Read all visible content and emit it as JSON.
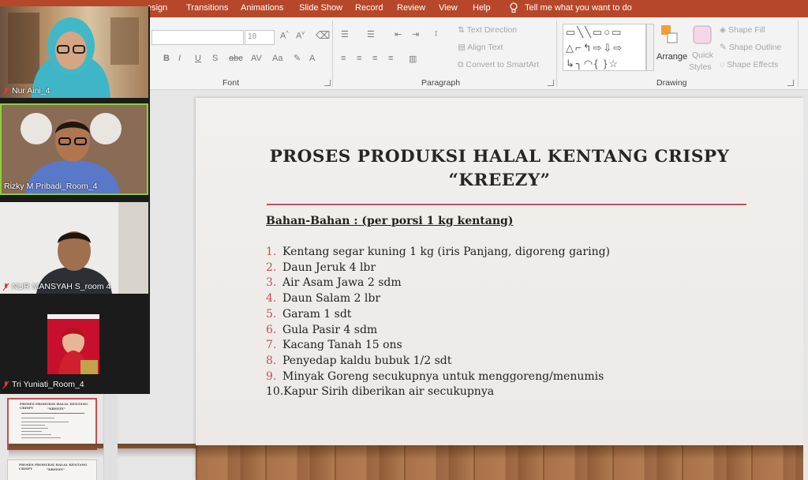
{
  "ribbon_tabs": [
    "esign",
    "Transitions",
    "Animations",
    "Slide Show",
    "Record",
    "Review",
    "View",
    "Help"
  ],
  "tell_me": "Tell me what you want to do",
  "font_group": {
    "label": "Font",
    "size_value": "18"
  },
  "paragraph_group": {
    "label": "Paragraph",
    "text_direction": "Text Direction",
    "align_text": "Align Text",
    "convert_smartart": "Convert to SmartArt"
  },
  "drawing_group": {
    "label": "Drawing",
    "arrange": "Arrange",
    "quick_styles_1": "Quick",
    "quick_styles_2": "Styles",
    "shape_fill": "Shape Fill",
    "shape_outline": "Shape Outline",
    "shape_effects": "Shape Effects"
  },
  "participants": [
    {
      "name": "Nur Aini_4"
    },
    {
      "name": "Rizky M Pribadi_Room_4"
    },
    {
      "name": "NUR MANSYAH S_room 4"
    },
    {
      "name": "Tri Yuniati_Room_4"
    }
  ],
  "slide": {
    "title_line1": "PROSES PRODUKSI HALAL KENTANG CRISPY",
    "title_line2": "“KREEZY”",
    "subheading": "Bahan-Bahan : (per porsi 1 kg kentang)",
    "items": [
      {
        "num": "1.",
        "text": "Kentang segar kuning 1 kg (iris Panjang, digoreng garing)"
      },
      {
        "num": "2.",
        "text": "Daun Jeruk 4 lbr"
      },
      {
        "num": "3.",
        "text": "Air Asam Jawa 2 sdm"
      },
      {
        "num": "4.",
        "text": "Daun Salam 2 lbr"
      },
      {
        "num": "5.",
        "text": "Garam 1 sdt"
      },
      {
        "num": "6.",
        "text": "Gula Pasir 4 sdm"
      },
      {
        "num": "7.",
        "text": "Kacang Tanah 15 ons"
      },
      {
        "num": "8.",
        "text": "Penyedap kaldu bubuk 1/2 sdt"
      },
      {
        "num": "9.",
        "text": "Minyak Goreng secukupnya untuk menggoreng/menumis"
      },
      {
        "num": "10.",
        "text": "Kapur Sirih diberikan air secukupnya"
      }
    ]
  },
  "thumbnail_title": "PROSES PRODUKSI HALAL KENTANG CRISPY",
  "thumbnail_subtitle": "\"KREEZY\"",
  "colors": {
    "ribbon": "#b7472a",
    "accent_line": "#c0505a",
    "active_speaker": "#8ccf3a"
  }
}
